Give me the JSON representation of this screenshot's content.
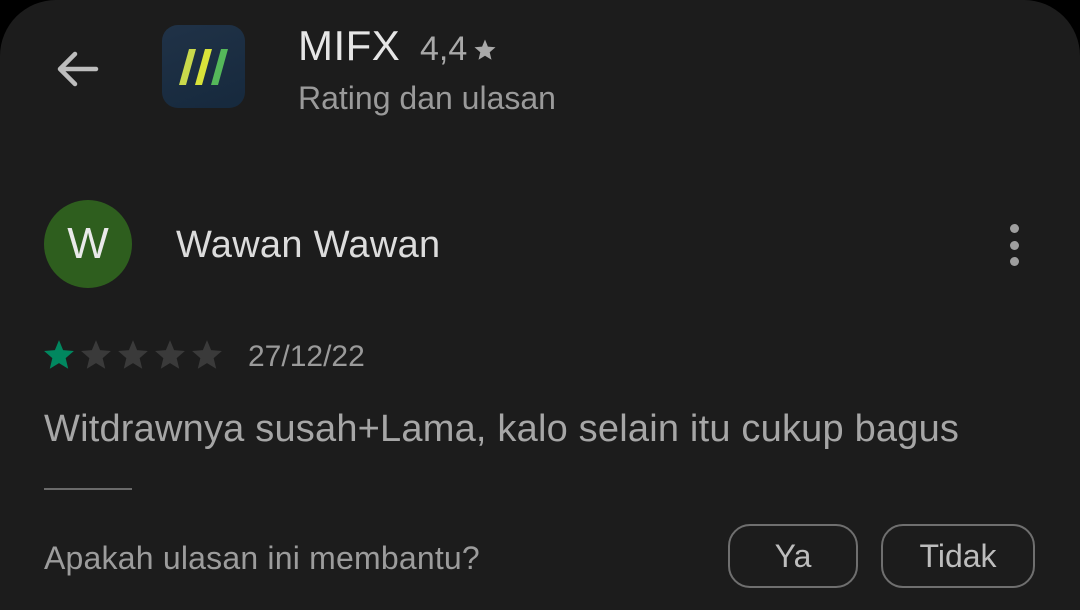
{
  "header": {
    "app_name": "MIFX",
    "rating": "4,4",
    "subtitle": "Rating dan ulasan"
  },
  "review": {
    "avatar_initial": "W",
    "reviewer_name": "Wawan Wawan",
    "stars_filled": 1,
    "stars_total": 5,
    "date": "27/12/22",
    "text": "Witdrawnya susah+Lama, kalo selain itu cukup bagus"
  },
  "helpful": {
    "question": "Apakah ulasan ini membantu?",
    "yes_label": "Ya",
    "no_label": "Tidak"
  },
  "colors": {
    "background": "#1c1c1c",
    "star_filled": "#01875f",
    "star_empty": "#3a3a3a",
    "avatar_bg": "#2e5e1e"
  },
  "icons": {
    "back": "back-arrow-icon",
    "rating_star": "star-icon",
    "more": "more-vert-icon",
    "app_logo": "mifx-logo-icon"
  }
}
